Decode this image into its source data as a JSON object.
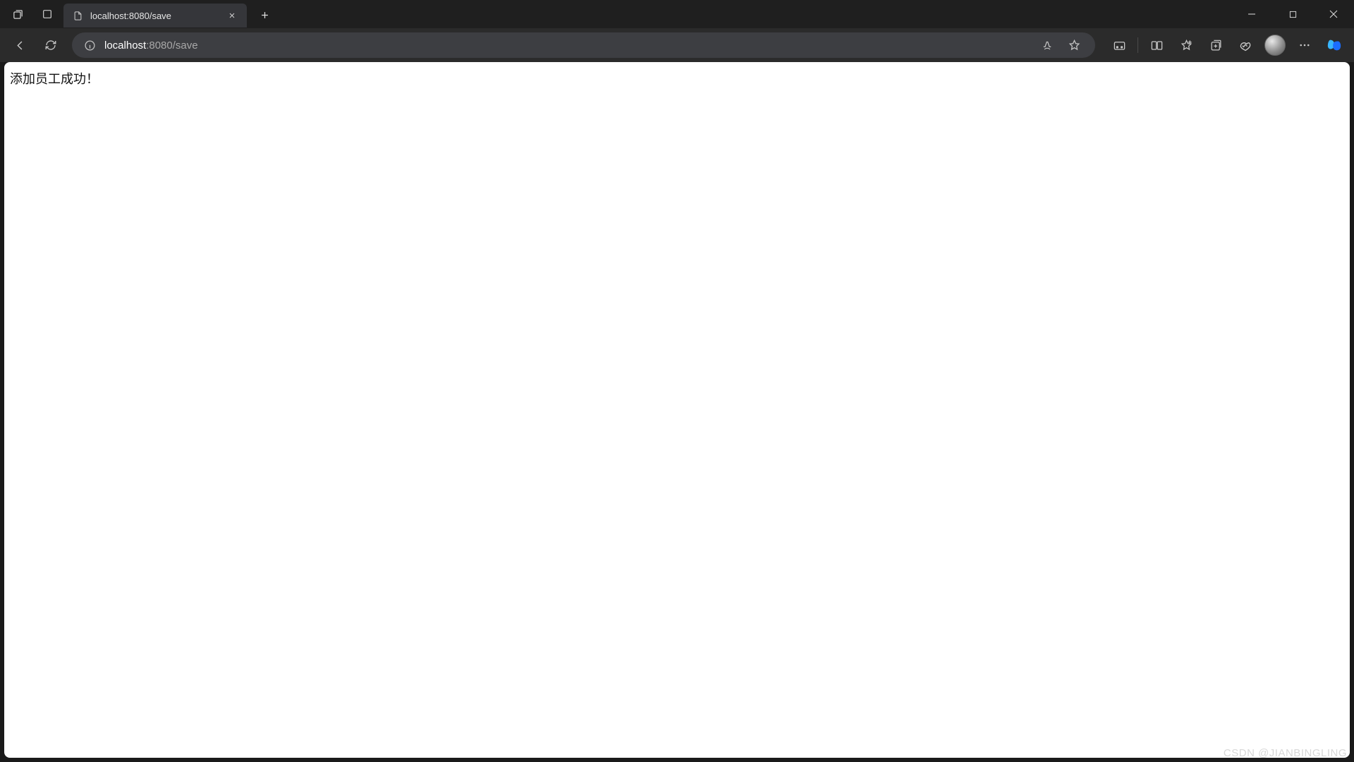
{
  "tab": {
    "title": "localhost:8080/save"
  },
  "address": {
    "host": "localhost",
    "rest": ":8080/save"
  },
  "page": {
    "message": "添加员工成功！"
  },
  "watermark": "CSDN @JIANBINGLING"
}
